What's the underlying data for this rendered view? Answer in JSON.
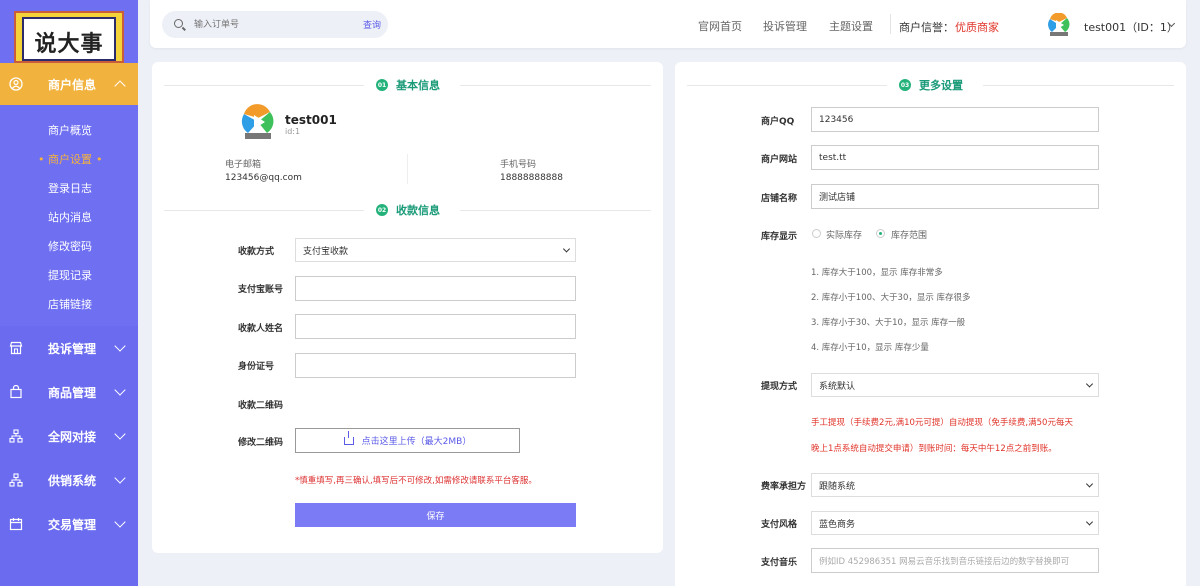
{
  "logo": {
    "text": "说大事"
  },
  "sidebar": {
    "active_section": {
      "label": "商户信息",
      "icon": "user-circle-icon"
    },
    "sub_items": [
      {
        "label": "商户概览"
      },
      {
        "label": "商户设置",
        "active": true
      },
      {
        "label": "登录日志"
      },
      {
        "label": "站内消息"
      },
      {
        "label": "修改密码"
      },
      {
        "label": "提现记录"
      },
      {
        "label": "店铺链接"
      }
    ],
    "sections": [
      {
        "label": "投诉管理",
        "icon": "store-icon"
      },
      {
        "label": "商品管理",
        "icon": "bag-icon"
      },
      {
        "label": "全网对接",
        "icon": "network-icon"
      },
      {
        "label": "供销系统",
        "icon": "network-icon"
      },
      {
        "label": "交易管理",
        "icon": "calendar-icon"
      }
    ]
  },
  "header": {
    "search": {
      "placeholder": "输入订单号",
      "button": "查询"
    },
    "links": [
      {
        "label": "官网首页"
      },
      {
        "label": "投诉管理"
      },
      {
        "label": "主题设置"
      }
    ],
    "credit_label": "商户信誉：",
    "credit_value": "优质商家",
    "user_label": "test001（ID：1）"
  },
  "basic_info": {
    "badge": "01",
    "title": "基本信息",
    "name": "test001",
    "id": "id:1",
    "email_label": "电子邮箱",
    "email_value": "123456@qq.com",
    "phone_label": "手机号码",
    "phone_value": "18888888888"
  },
  "payment_info": {
    "badge": "02",
    "title": "收款信息",
    "method_label": "收款方式",
    "method_value": "支付宝收款",
    "alipay_label": "支付宝账号",
    "payee_label": "收款人姓名",
    "idcard_label": "身份证号",
    "qr_label": "收款二维码",
    "edit_qr_label": "修改二维码",
    "upload_text": "点击这里上传（最大2MB）",
    "warning": "*慎重填写,再三确认,填写后不可修改,如需修改请联系平台客服。",
    "save": "保存"
  },
  "more_settings": {
    "badge": "03",
    "title": "更多设置",
    "qq_label": "商户QQ",
    "qq_value": "123456",
    "site_label": "商户网站",
    "site_value": "test.tt",
    "shop_label": "店铺名称",
    "shop_value": "测试店铺",
    "stock_label": "库存显示",
    "stock_option_1": "实际库存",
    "stock_option_2": "库存范围",
    "stock_notes": [
      "1. 库存大于100，显示 库存非常多",
      "2. 库存小于100、大于30，显示 库存很多",
      "3. 库存小于30、大于10，显示 库存一般",
      "4. 库存小于10，显示 库存少量"
    ],
    "withdraw_label": "提现方式",
    "withdraw_value": "系统默认",
    "withdraw_note_1": "手工提现（手续费2元,满10元可提）自动提现（免手续费,满50元每天",
    "withdraw_note_2": "晚上1点系统自动提交申请）到账时间：每天中午12点之前到账。",
    "fee_label": "费率承担方",
    "fee_value": "跟随系统",
    "style_label": "支付风格",
    "style_value": "蓝色商务",
    "music_label": "支付音乐",
    "music_placeholder": "例如ID 452986351 网易云音乐找到音乐链接后边的数字替换即可"
  },
  "colors": {
    "sidebar": "#6f6ff2",
    "active": "#f2b23e",
    "accent": "#24b27b",
    "primary": "#7b7bf5",
    "danger": "#e0342a"
  }
}
